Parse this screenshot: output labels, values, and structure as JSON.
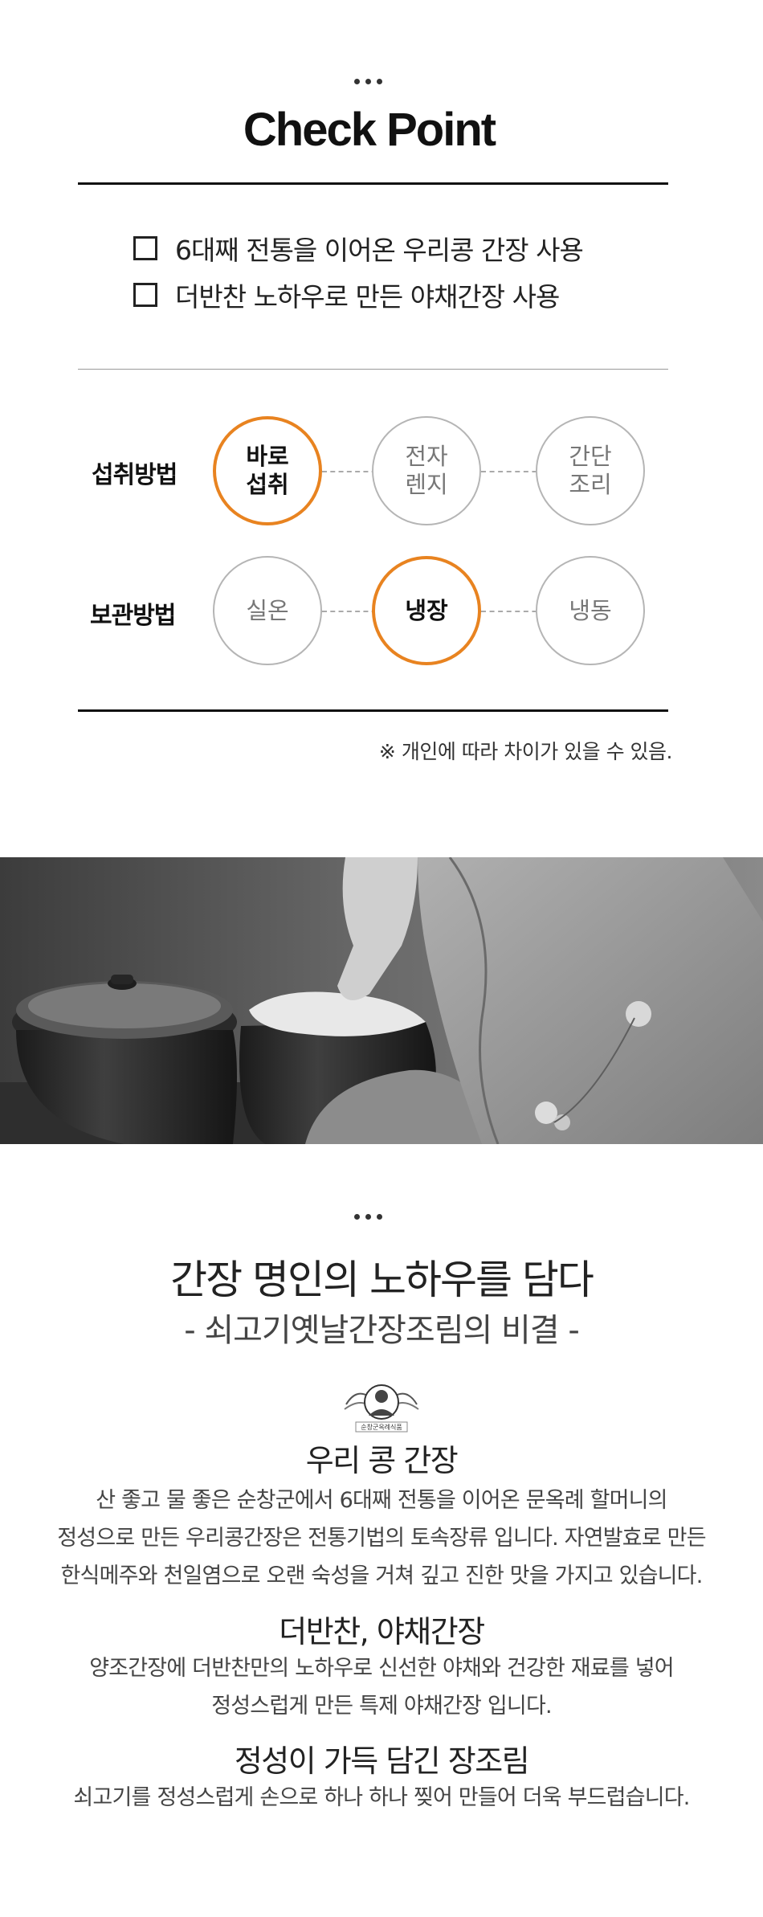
{
  "checkpoint": {
    "title": "Check Point",
    "items": [
      "6대째 전통을 이어온 우리콩 간장 사용",
      "더반찬 노하우로 만든 야채간장 사용"
    ]
  },
  "methods": [
    {
      "label": "섭취방법",
      "options": [
        "바로\n섭취",
        "전자\n렌지",
        "간단\n조리"
      ],
      "selected": 0
    },
    {
      "label": "보관방법",
      "options": [
        "실온",
        "냉장",
        "냉동"
      ],
      "selected": 1
    }
  ],
  "note": "※ 개인에 따라 차이가 있을 수 있음.",
  "colors": {
    "accent": "#e88320",
    "text": "#222222",
    "rule": "#111111"
  },
  "story": {
    "title": "간장 명인의 노하우를 담다",
    "subtitle": "- 쇠고기옛날간장조림의 비결 -",
    "logo_text": "순창군옥례식품",
    "sections": [
      {
        "heading": "우리 콩 간장",
        "lines": [
          "산 좋고 물 좋은 순창군에서 6대째 전통을 이어온 문옥례 할머니의",
          "정성으로 만든 우리콩간장은 전통기법의 토속장류 입니다. 자연발효로 만든",
          "한식메주와 천일염으로 오랜 숙성을 거쳐 깊고 진한 맛을 가지고 있습니다."
        ]
      },
      {
        "heading": "더반찬, 야채간장",
        "lines": [
          "양조간장에 더반찬만의 노하우로 신선한 야채와 건강한 재료를 넣어",
          "정성스럽게 만든 특제 야채간장 입니다."
        ]
      },
      {
        "heading": "정성이 가득 담긴 장조림",
        "lines": [
          "쇠고기를 정성스럽게 손으로 하나 하나 찢어 만들어 더욱 부드럽습니다."
        ]
      }
    ]
  }
}
